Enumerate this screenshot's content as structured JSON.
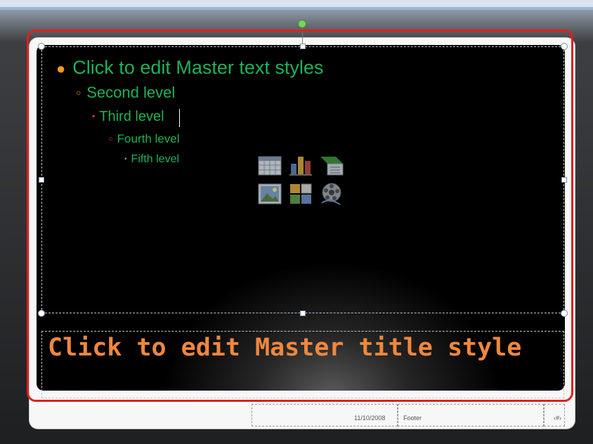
{
  "body_placeholder": {
    "level1": "Click to edit Master text styles",
    "level2": "Second level",
    "level3": "Third level",
    "level4": "Fourth level",
    "level5": "Fifth level"
  },
  "title_placeholder": {
    "text": "Click to edit Master title style"
  },
  "footer": {
    "date": "11/10/2008",
    "footer_text": "Footer",
    "slide_number": "‹#›"
  },
  "content_icons": [
    "insert-table-icon",
    "insert-chart-icon",
    "insert-smartart-icon",
    "insert-picture-icon",
    "insert-clipart-icon",
    "insert-media-icon"
  ],
  "colors": {
    "text_green": "#1fb257",
    "title_orange": "#f0873d",
    "bullet_orange": "#f39a1e",
    "bullet_red": "#e0332d",
    "selection_outline": "#e0201b"
  }
}
